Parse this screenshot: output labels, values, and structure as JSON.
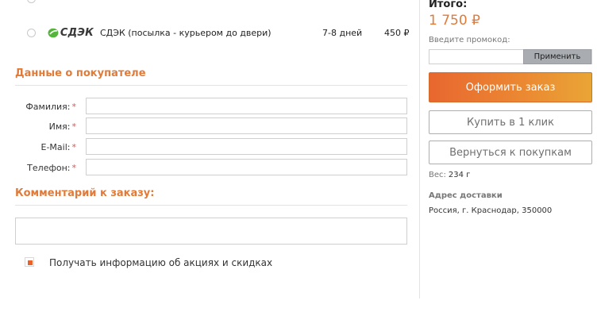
{
  "shipping": {
    "option": {
      "logo_text": "СДЭК",
      "name": "СДЭК (посылка - курьером до двери)",
      "days": "7-8 дней",
      "price": "450 ₽",
      "selected": false
    }
  },
  "buyer": {
    "title": "Данные о покупателе",
    "fields": [
      {
        "label": "Фамилия:",
        "required": "*",
        "value": ""
      },
      {
        "label": "Имя:",
        "required": "*",
        "value": ""
      },
      {
        "label": "E-Mail:",
        "required": "*",
        "value": ""
      },
      {
        "label": "Телефон:",
        "required": "*",
        "value": ""
      }
    ]
  },
  "comment": {
    "title": "Комментарий к заказу:",
    "value": ""
  },
  "subscribe": {
    "label": "Получать информацию об акциях и скидках",
    "checked": true
  },
  "summary": {
    "total_label": "Итого:",
    "total_value": "1 750 ₽",
    "promo_label": "Введите промокод:",
    "promo_value": "",
    "promo_button": "Применить",
    "order_button": "Оформить заказ",
    "one_click_button": "Купить в 1 клик",
    "back_button": "Вернуться к покупкам",
    "weight_label": "Вес:",
    "weight_value": "234 г",
    "address_label": "Адрес доставки",
    "address_value": "Россия, г. Краснодар, 350000"
  },
  "colors": {
    "accent": "#e07b39",
    "button_gradient_start": "#e8672f",
    "button_gradient_end": "#e9a536",
    "cdek_green": "#55b53a"
  }
}
